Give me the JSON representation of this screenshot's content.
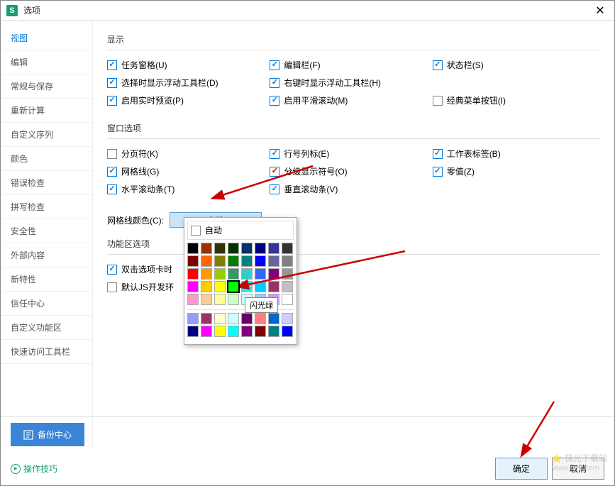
{
  "titlebar": {
    "title": "选项",
    "icon": "S"
  },
  "sidebar": {
    "items": [
      "视图",
      "编辑",
      "常规与保存",
      "重新计算",
      "自定义序列",
      "颜色",
      "错误检查",
      "拼写检查",
      "安全性",
      "外部内容",
      "新特性",
      "信任中心",
      "自定义功能区",
      "快速访问工具栏"
    ],
    "active_index": 0
  },
  "sections": {
    "display": {
      "title": "显示",
      "opts": [
        {
          "label": "任务窗格(U)",
          "checked": true
        },
        {
          "label": "编辑栏(F)",
          "checked": true
        },
        {
          "label": "状态栏(S)",
          "checked": true
        },
        {
          "label": "选择时显示浮动工具栏(D)",
          "checked": true
        },
        {
          "label": "右键时显示浮动工具栏(H)",
          "checked": true
        },
        {
          "label": "",
          "checked": null
        },
        {
          "label": "启用实时预览(P)",
          "checked": true
        },
        {
          "label": "启用平滑滚动(M)",
          "checked": true
        },
        {
          "label": "经典菜单按钮(I)",
          "checked": false
        }
      ]
    },
    "window": {
      "title": "窗口选项",
      "opts": [
        {
          "label": "分页符(K)",
          "checked": false
        },
        {
          "label": "行号列标(E)",
          "checked": true
        },
        {
          "label": "工作表标签(B)",
          "checked": true
        },
        {
          "label": "网格线(G)",
          "checked": true
        },
        {
          "label": "分级显示符号(O)",
          "checked": true,
          "red": true
        },
        {
          "label": "零值(Z)",
          "checked": true
        },
        {
          "label": "水平滚动条(T)",
          "checked": true
        },
        {
          "label": "垂直滚动条(V)",
          "checked": true
        }
      ],
      "gridcolor_label": "网格线颜色(C):",
      "gridcolor_value": "自动"
    },
    "ribbon": {
      "title": "功能区选项",
      "opts": [
        {
          "label": "双击选项卡时",
          "checked": true
        },
        {
          "label": "默认JS开发环",
          "checked": false
        }
      ]
    }
  },
  "colorpicker": {
    "auto_label": "自动",
    "tooltip": "闪光绿",
    "rows": [
      [
        "#000000",
        "#993300",
        "#333300",
        "#003300",
        "#003366",
        "#000080",
        "#333399",
        "#333333"
      ],
      [
        "#800000",
        "#ff6600",
        "#808000",
        "#008000",
        "#008080",
        "#0000ff",
        "#666699",
        "#808080"
      ],
      [
        "#ff0000",
        "#ff9900",
        "#99cc00",
        "#339966",
        "#33cccc",
        "#3366ff",
        "#800080",
        "#969696"
      ],
      [
        "#ff00ff",
        "#ffcc00",
        "#ffff00",
        "#00ff00",
        "#00ffff",
        "#00ccff",
        "#993366",
        "#c0c0c0"
      ],
      [
        "#ff99cc",
        "#ffcc99",
        "#ffff99",
        "#ccffcc",
        "#ccffff",
        "#99ccff",
        "#cc99ff",
        "#ffffff"
      ]
    ],
    "rows2": [
      [
        "#9999ff",
        "#993366",
        "#ffffcc",
        "#ccffff",
        "#660066",
        "#ff8080",
        "#0066cc",
        "#ccccff"
      ],
      [
        "#000080",
        "#ff00ff",
        "#ffff00",
        "#00ffff",
        "#800080",
        "#800000",
        "#008080",
        "#0000ff"
      ]
    ],
    "selected": [
      3,
      3
    ]
  },
  "bottom": {
    "backup": "备份中心",
    "tips": "操作技巧",
    "ok": "确定",
    "cancel": "取消"
  },
  "watermark": {
    "main": "极光下载站",
    "sub": "www.xz7.com"
  }
}
